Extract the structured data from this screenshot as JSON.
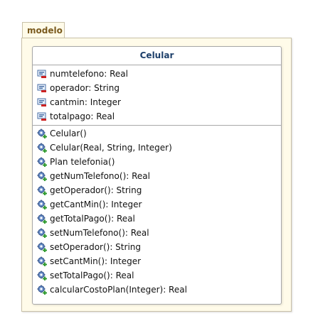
{
  "package": {
    "name": "modelo"
  },
  "class": {
    "name": "Celular",
    "attributes": [
      "numtelefono: Real",
      "operador: String",
      "cantmin: Integer",
      "totalpago: Real"
    ],
    "operations": [
      "Celular()",
      "Celular(Real, String, Integer)",
      "Plan telefonia()",
      "getNumTelefono(): Real",
      "getOperador(): String",
      "getCantMin(): Integer",
      "getTotalPago(): Real",
      "setNumTelefono(): Real",
      "setOperador(): String",
      "setCantMin(): Integer",
      "setTotalPago(): Real",
      "calcularCostoPlan(Integer): Real"
    ]
  },
  "icons": {
    "attribute": "private-field-icon",
    "operation": "public-operation-icon"
  },
  "colors": {
    "package_fill": "#fffbe9",
    "package_label": "#7a5a1e",
    "class_name": "#1d3f6a",
    "private_marker": "#cc2222",
    "public_marker": "#2e9a2e"
  }
}
